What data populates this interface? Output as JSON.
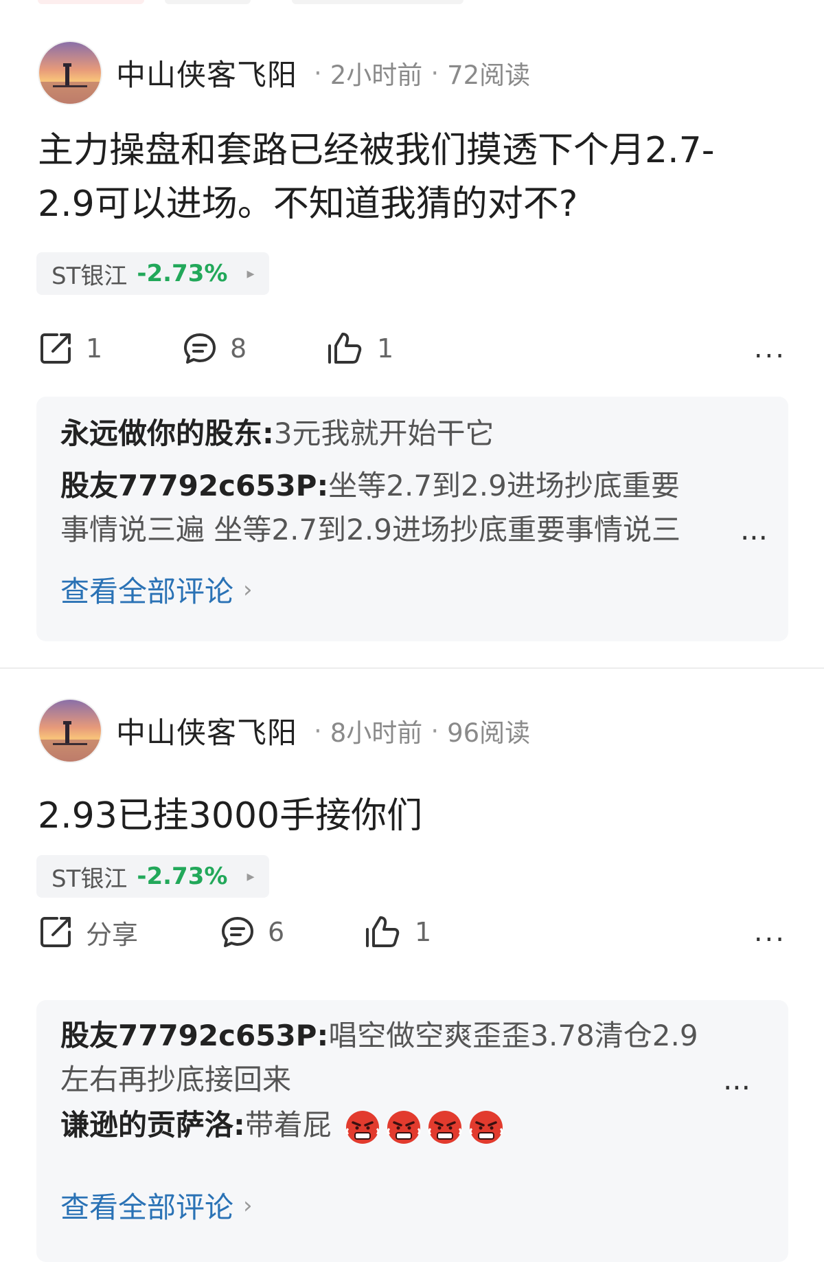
{
  "posts": [
    {
      "author": "中山侠客飞阳",
      "time": "2小时前",
      "reads": "72阅读",
      "content_line1": "主力操盘和套路已经被我们摸透下个月2.7-",
      "content_line2": "2.9可以进场。不知道我猜的对不?",
      "stock": {
        "name": "ST银江",
        "change": "-2.73%"
      },
      "actions": {
        "share": "1",
        "comment": "8",
        "like": "1"
      },
      "comments": [
        {
          "user": "永远做你的股东:",
          "text": "3元我就开始干它"
        },
        {
          "user": "股友77792c653P:",
          "text_line1": "坐等2.7到2.9进场抄底重要",
          "text_line2": "事情说三遍  坐等2.7到2.9进场抄底重要事情说三",
          "ellipsis": "..."
        }
      ],
      "view_all": "查看全部评论"
    },
    {
      "author": "中山侠客飞阳",
      "time": "8小时前",
      "reads": "96阅读",
      "content_line1": "2.93已挂3000手接你们",
      "stock": {
        "name": "ST银江",
        "change": "-2.73%"
      },
      "actions": {
        "share": "分享",
        "comment": "6",
        "like": "1"
      },
      "comments": [
        {
          "user": "股友77792c653P:",
          "text_line1": "唱空做空爽歪歪3.78清仓2.9",
          "text_line2": "左右再抄底接回来",
          "ellipsis": "..."
        },
        {
          "user": "谦逊的贡萨洛:",
          "text": "带着屁"
        }
      ],
      "view_all": "查看全部评论"
    }
  ],
  "separator": "·",
  "more": "...",
  "chevron": "›",
  "arrow": "▸",
  "colors": {
    "down": "#22a85a",
    "link": "#2a72b5"
  },
  "icons": [
    "share-icon",
    "comment-icon",
    "like-icon",
    "more-icon",
    "angry-emoji-icon"
  ]
}
